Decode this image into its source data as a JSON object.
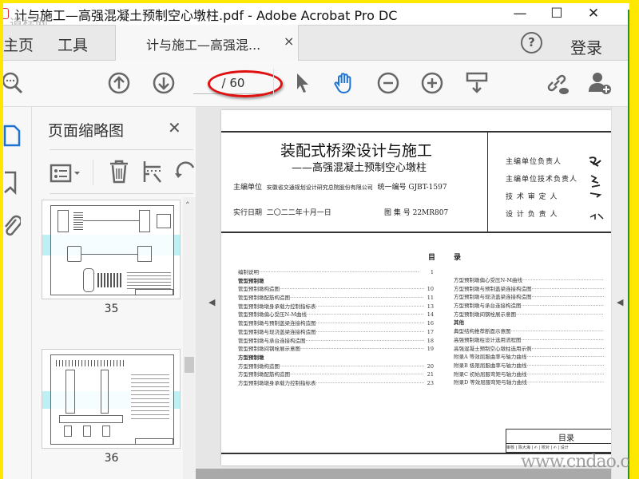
{
  "window": {
    "title": "计与施工—高强混凝土预制空心墩柱.pdf - Adobe Acrobat Pro DC",
    "watermark_top": "道标网",
    "watermark_bottom": "www.cndao.com",
    "minimize": "—",
    "maximize": "☐",
    "close": "✕"
  },
  "tabs": {
    "home": "主页",
    "tools": "工具",
    "document": "计与施工—高强混...",
    "document_close": "×",
    "help": "?",
    "login": "登录"
  },
  "toolbar": {
    "page_total": "/ 60",
    "accent": "#1e73d2",
    "highlight": "#e01010"
  },
  "panel": {
    "title": "页面缩略图",
    "close": "✕",
    "thumbnails": [
      {
        "label": "35"
      },
      {
        "label": "36"
      }
    ]
  },
  "document": {
    "title": "装配式桥梁设计与施工",
    "subtitle": "——高强混凝土预制空心墩柱",
    "org_label": "主编单位",
    "org": "安徽省交通规划设计研究总院股份有限公司",
    "code_label": "统一编号",
    "code": "GJBT-1597",
    "date_label": "实行日期",
    "date": "二〇二二年十月一日",
    "atlas_label": "图 集 号",
    "atlas": "22MR807",
    "roles": [
      "主编单位负责人",
      "主编单位技术负责人",
      "技 术 审 定 人",
      "设 计 负 责 人"
    ],
    "toc_heading_left": "目",
    "toc_heading_right": "录",
    "toc_left": [
      {
        "label": "编制说明",
        "page": "1"
      },
      {
        "label": "管型预制墩",
        "page": "",
        "heading": true
      },
      {
        "label": "管型预制墩构造图",
        "page": "10"
      },
      {
        "label": "管型预制墩配筋构造图",
        "page": "11"
      },
      {
        "label": "管型预制墩墩身承载力控制指标表",
        "page": "13"
      },
      {
        "label": "管型预制墩偏心受压N-M曲线",
        "page": "14"
      },
      {
        "label": "管型预制墩与预制盖梁连接构造图",
        "page": "16"
      },
      {
        "label": "管型预制墩与现浇盖梁连接构造图",
        "page": "17"
      },
      {
        "label": "管型预制墩与承台连接构造图",
        "page": "18"
      },
      {
        "label": "管型预制墩间钢栓展示意图",
        "page": "19"
      },
      {
        "label": "方型预制墩",
        "page": "",
        "heading": true
      },
      {
        "label": "方型预制墩构造图",
        "page": "20"
      },
      {
        "label": "方型预制墩配筋构造图",
        "page": "21"
      },
      {
        "label": "方型预制墩墩身承载力控制指标表",
        "page": "23"
      }
    ],
    "toc_right": [
      {
        "label": "方型预制墩偏心受压N-M曲线",
        "page": ""
      },
      {
        "label": "方型预制墩与预制盖梁连接构造图",
        "page": ""
      },
      {
        "label": "方型预制墩与现浇盖梁连接构造图",
        "page": ""
      },
      {
        "label": "方型预制墩与承台连接构造图",
        "page": ""
      },
      {
        "label": "方型预制墩间钢栓展示意图",
        "page": ""
      },
      {
        "label": "其他",
        "page": "",
        "heading": true
      },
      {
        "label": "典型结构推荐断面示意图",
        "page": ""
      },
      {
        "label": "高强预制墩柱设计选用流程图",
        "page": ""
      },
      {
        "label": "高强混凝土预制空心墩柱选用示例",
        "page": ""
      },
      {
        "label": "附录A 等效屈服曲率与轴力曲线",
        "page": ""
      },
      {
        "label": "附录B 极限屈服曲率与轴力曲线",
        "page": ""
      },
      {
        "label": "附录C 初始屈服弯矩与轴力曲线",
        "page": ""
      },
      {
        "label": "附录D 等效屈服弯矩与轴力曲线",
        "page": ""
      }
    ],
    "titleblock": {
      "name": "目录",
      "cells": [
        "审核",
        "陈大海",
        "校对",
        "设计"
      ]
    }
  }
}
